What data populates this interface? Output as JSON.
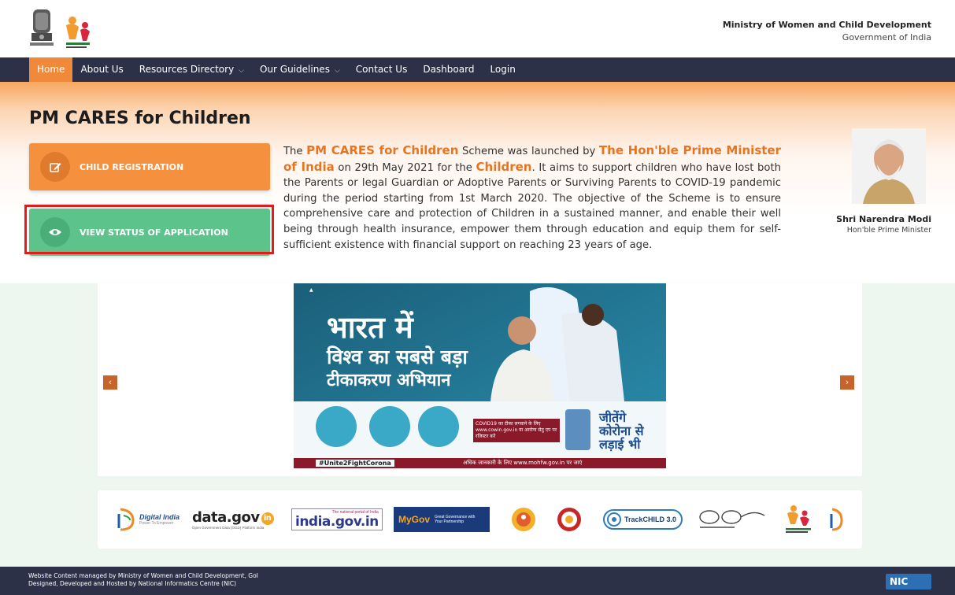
{
  "header": {
    "ministry_line1": "Ministry of Women and Child Development",
    "ministry_line2": "Government of India"
  },
  "nav": {
    "items": [
      {
        "label": "Home",
        "active": true
      },
      {
        "label": "About Us"
      },
      {
        "label": "Resources Directory",
        "dropdown": true
      },
      {
        "label": "Our Guidelines",
        "dropdown": true
      },
      {
        "label": "Contact Us"
      },
      {
        "label": "Dashboard"
      },
      {
        "label": "Login"
      }
    ]
  },
  "main": {
    "title": "PM CARES for Children",
    "child_registration_label": "CHILD REGISTRATION",
    "view_status_label": "VIEW STATUS OF APPLICATION",
    "description": {
      "p1": "The ",
      "h1": "PM CARES for Children",
      "p2": " Scheme was launched by ",
      "h2": "The Hon'ble Prime Minister of India",
      "p3": " on 29th May 2021 for the ",
      "h3": "Children",
      "p4": ". It aims to support children who have lost both the Parents or legal Guardian or Adoptive Parents or Surviving Parents to COVID-19 pandemic during the period starting from 1st March 2020. The objective of the Scheme is to ensure comprehensive care and protection of Children in a sustained manner, and enable their well being through health insurance, empower them through education and equip them for self-sufficient existence with financial support on reaching 23 years of age."
    },
    "pm_name": "Shri Narendra Modi",
    "pm_title": "Hon'ble Prime Minister"
  },
  "carousel": {
    "prev_icon": "‹",
    "next_icon": "›",
    "banner": {
      "line1": "भारत में",
      "line2": "विश्व का सबसे बड़ा",
      "line3": "टीकाकरण अभियान",
      "right1": "जीतेंगे",
      "right2": "कोरोना से",
      "right3": "लड़ाई भी",
      "hashtag": "#Unite2FightCorona",
      "footer_note": "अधिक जानकारी के लिए www.mohfw.gov.in पर जाएं",
      "cowin_note": "COVID19 का टीका लगवाने के लिए www.cowin.gov.in या आरोग्य सेतु एप पर रजिस्टर करें"
    }
  },
  "partners": {
    "digital_india": "Digital India",
    "digital_india_tag": "Power To Empower",
    "data_gov": "data.gov",
    "data_gov_in": "in",
    "data_gov_tag": "Open Government Data (OGD) Platform India",
    "india_gov": "india.gov.in",
    "india_gov_tag": "The national portal of India",
    "mygov": "MyGov",
    "mygov_tag": "Great Governance with Your Partnership",
    "trackchild": "TrackCHILD 3.0"
  },
  "footer": {
    "line1": "Website Content managed by Ministry of Women and Child Development, GoI",
    "line2": "Designed, Developed and Hosted by National Informatics Centre (NIC)",
    "nic": "NIC"
  },
  "colors": {
    "nav_bg": "#2c3147",
    "accent_orange": "#f5913e",
    "accent_green": "#5cc48a",
    "highlight_red": "#e21b1b"
  }
}
